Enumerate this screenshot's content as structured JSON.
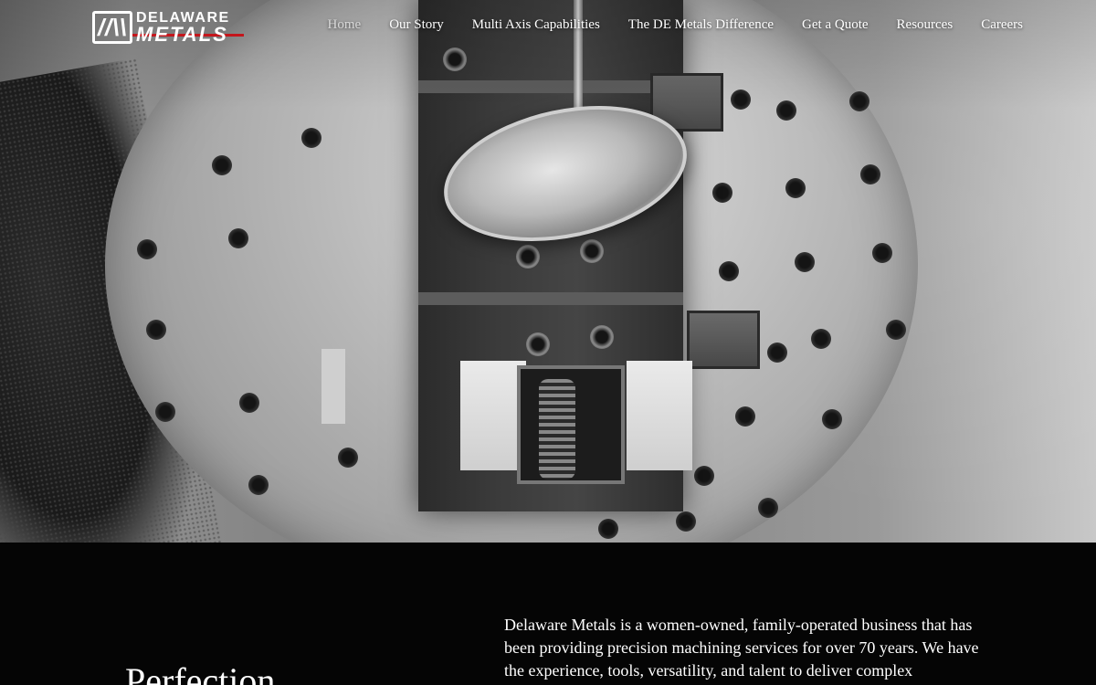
{
  "brand": {
    "logo_line1": "DELAWARE",
    "logo_line2": "METALS",
    "accent_color": "#c4161c"
  },
  "nav": {
    "items": [
      {
        "label": "Home",
        "active": true
      },
      {
        "label": "Our Story",
        "active": false
      },
      {
        "label": "Multi Axis Capabilities",
        "active": false
      },
      {
        "label": "The DE Metals Difference",
        "active": false
      },
      {
        "label": "Get a Quote",
        "active": false
      },
      {
        "label": "Resources",
        "active": false
      },
      {
        "label": "Careers",
        "active": false
      }
    ]
  },
  "hero": {
    "image_subject": "cnc-machining-vise-icon"
  },
  "intro": {
    "heading": "Perfection",
    "body": "Delaware Metals is a women-owned, family-operated business that has been providing precision machining services for over 70 years. We have the experience, tools, versatility, and talent to deliver complex"
  }
}
